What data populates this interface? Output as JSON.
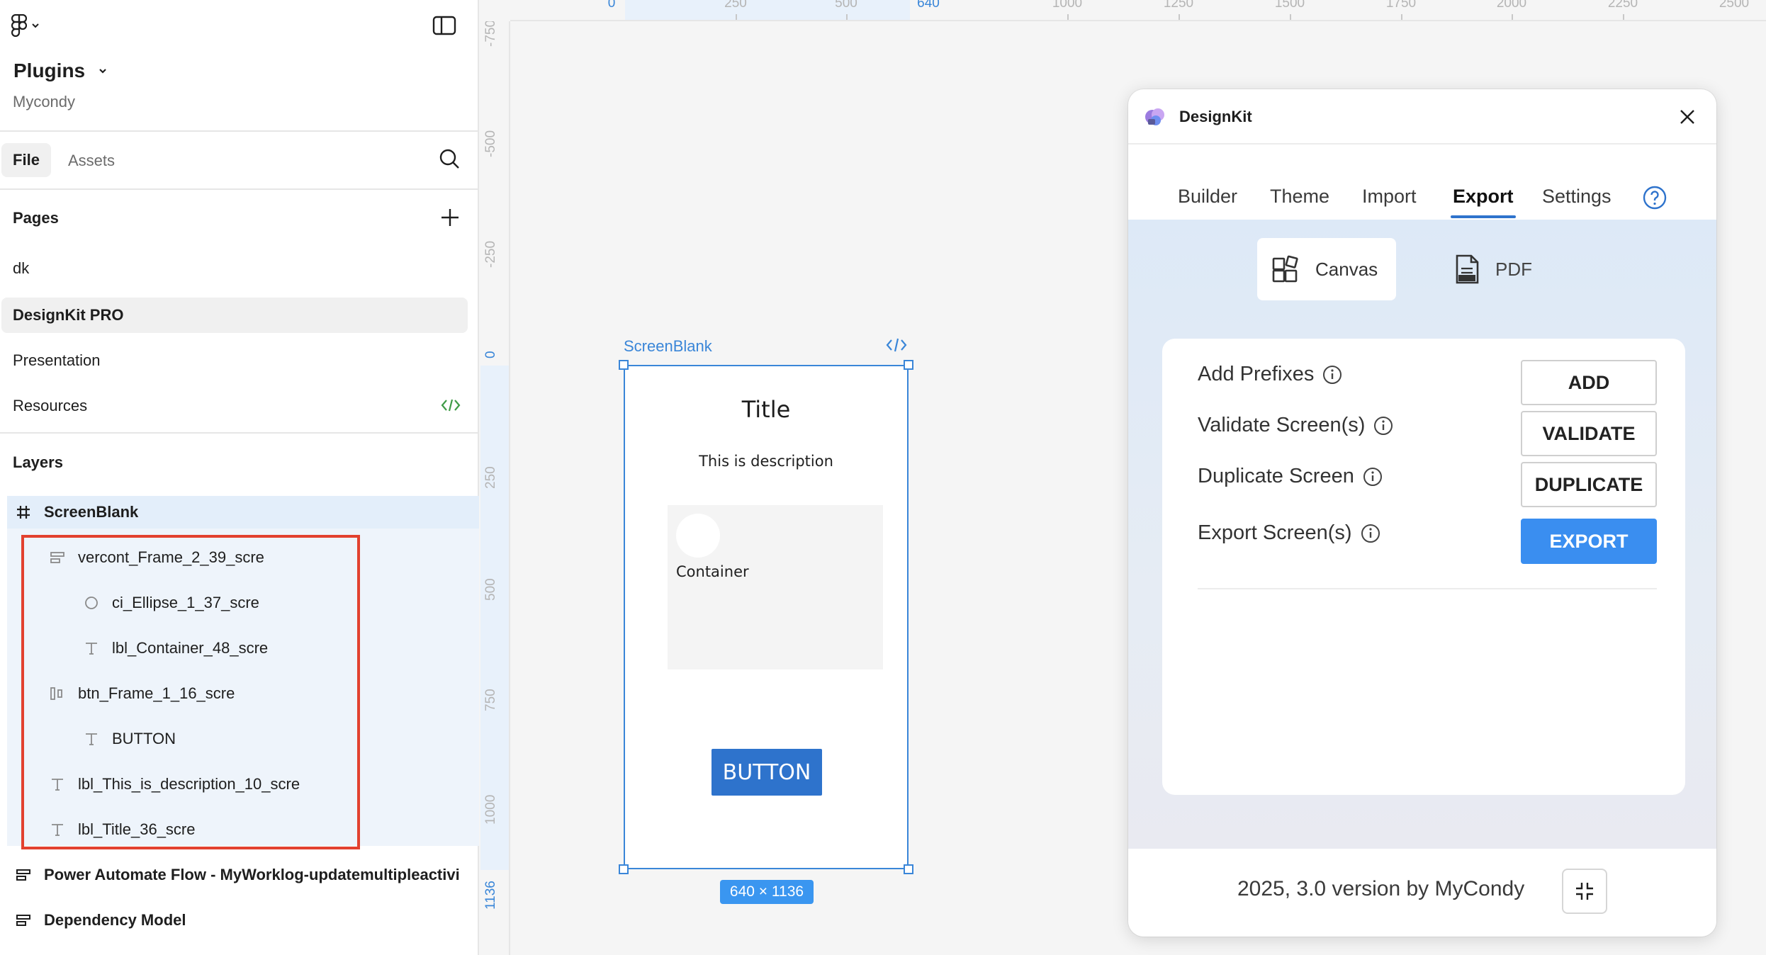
{
  "sidebar": {
    "file_title": "Plugins",
    "team_name": "Mycondy",
    "tabs": {
      "file": "File",
      "assets": "Assets"
    },
    "pages_label": "Pages",
    "pages": [
      {
        "label": "dk"
      },
      {
        "label": "DesignKit PRO",
        "active": true
      },
      {
        "label": "Presentation"
      },
      {
        "label": "Resources"
      }
    ],
    "layers_label": "Layers",
    "layers": [
      {
        "label": "ScreenBlank",
        "icon": "frame-icon"
      },
      {
        "label": "vercont_Frame_2_39_scre",
        "icon": "vertical-stack-icon"
      },
      {
        "label": "ci_Ellipse_1_37_scre",
        "icon": "ellipse-icon"
      },
      {
        "label": "lbl_Container_48_scre",
        "icon": "text-icon"
      },
      {
        "label": "btn_Frame_1_16_scre",
        "icon": "horizontal-stack-icon"
      },
      {
        "label": "BUTTON",
        "icon": "text-icon"
      },
      {
        "label": "lbl_This_is_description_10_scre",
        "icon": "text-icon"
      },
      {
        "label": "lbl_Title_36_scre",
        "icon": "text-icon"
      },
      {
        "label": "Power Automate Flow - MyWorklog-updatemultipleactivi",
        "icon": "vertical-stack-icon"
      },
      {
        "label": "Dependency Model",
        "icon": "vertical-stack-icon"
      }
    ]
  },
  "rulers": {
    "top": [
      "0",
      "250",
      "500",
      "640",
      "1000",
      "1250",
      "1500",
      "1750",
      "2000",
      "2250",
      "2500"
    ],
    "left": [
      "-750",
      "-500",
      "-250",
      "0",
      "250",
      "500",
      "750",
      "1000",
      "1136"
    ]
  },
  "canvas": {
    "frame_name": "ScreenBlank",
    "frame_size": "640 × 1136",
    "frame_content": {
      "title": "Title",
      "description": "This is description",
      "container_label": "Container",
      "button_label": "BUTTON"
    }
  },
  "plugin": {
    "name": "DesignKit",
    "tabs": [
      "Builder",
      "Theme",
      "Import",
      "Export",
      "Settings"
    ],
    "active_tab": "Export",
    "segments": {
      "canvas": "Canvas",
      "pdf": "PDF"
    },
    "rows": [
      {
        "label": "Add Prefixes",
        "button": "ADD"
      },
      {
        "label": "Validate Screen(s)",
        "button": "VALIDATE"
      },
      {
        "label": "Duplicate Screen",
        "button": "DUPLICATE"
      },
      {
        "label": "Export Screen(s)",
        "button": "EXPORT"
      }
    ],
    "footer": "2025, 3.0 version by MyCondy",
    "colors": {
      "accent": "#3a8ef0",
      "selection": "#3a86d8",
      "highlight": "#e2412f"
    }
  }
}
